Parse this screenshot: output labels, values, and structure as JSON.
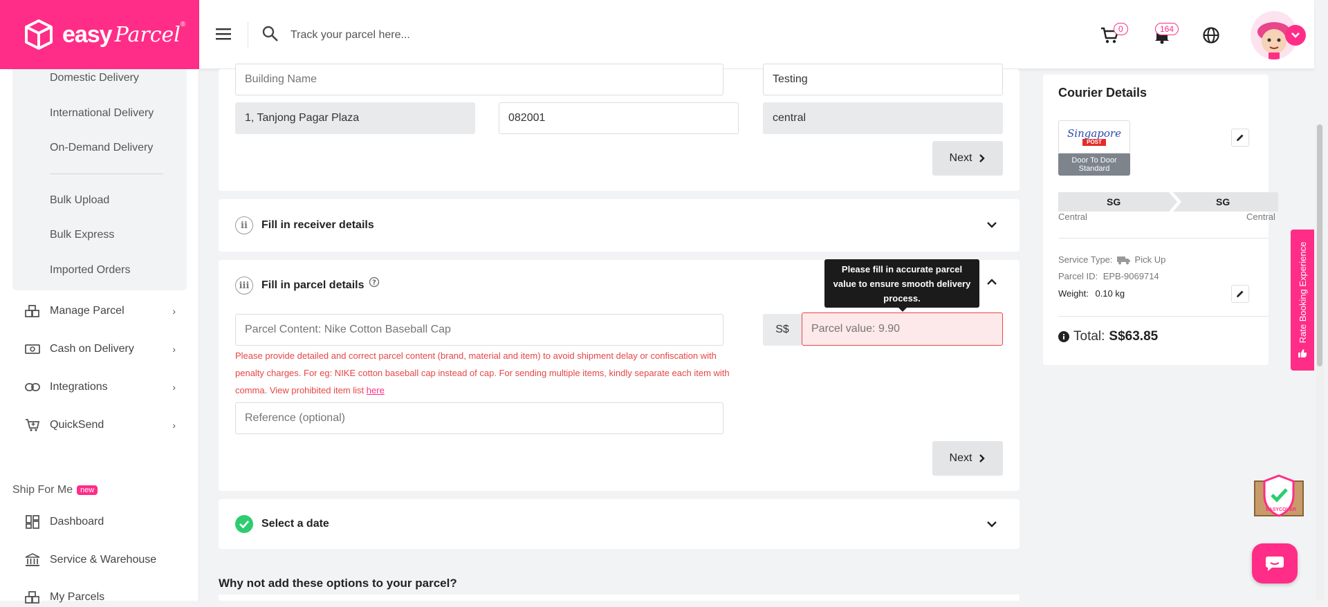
{
  "brand": {
    "name_bold": "easy",
    "name_script": "Parcel",
    "reg": "®"
  },
  "header": {
    "search_placeholder": "Track your parcel here...",
    "cart_count": "0",
    "notification_count": "164"
  },
  "sidebar": {
    "sub_items": [
      "Domestic Delivery",
      "International Delivery",
      "On-Demand Delivery",
      "Bulk Upload",
      "Bulk Express",
      "Imported Orders"
    ],
    "nav": [
      {
        "label": "Manage Parcel",
        "icon": "boxes-icon"
      },
      {
        "label": "Cash on Delivery",
        "icon": "cash-icon"
      },
      {
        "label": "Integrations",
        "icon": "link-icon"
      },
      {
        "label": "QuickSend",
        "icon": "cart-plus-icon"
      }
    ],
    "ship_for_me": {
      "label": "Ship For Me",
      "badge": "new"
    },
    "ship_nav": [
      {
        "label": "Dashboard",
        "icon": "dashboard-icon"
      },
      {
        "label": "Service & Warehouse",
        "icon": "bank-icon"
      },
      {
        "label": "My Parcels",
        "icon": "boxes-icon"
      }
    ]
  },
  "sender": {
    "building_placeholder": "Building Name",
    "name_value": "Testing",
    "address_value": "1, Tanjong Pagar Plaza",
    "postcode_value": "082001",
    "region_value": "central",
    "next_label": "Next"
  },
  "receiver": {
    "roman": "ii",
    "title": "Fill in receiver details"
  },
  "parcel": {
    "roman": "iii",
    "title": "Fill in parcel details",
    "content_placeholder": "Parcel Content: Nike Cotton Baseball Cap",
    "currency": "S$",
    "value_placeholder": "Parcel value: 9.90",
    "tooltip": "Please fill in accurate parcel value to ensure smooth delivery process.",
    "warning": "Please provide detailed and correct parcel content (brand, material and item) to avoid shipment delay or confiscation with penalty charges. For eg: NIKE cotton baseball cap instead of cap. For sending multiple items, kindly separate each item with comma. View prohibited item list",
    "warning_link": "here",
    "reference_placeholder": "Reference (optional)",
    "next_label": "Next"
  },
  "date": {
    "title": "Select a date"
  },
  "addons_heading": "Why not add these options to your parcel?",
  "courier": {
    "title": "Courier Details",
    "logo_text": "Singapore",
    "logo_sub": "POST",
    "service_badge": "Door To Door Standard",
    "from_code": "SG",
    "to_code": "SG",
    "from_region": "Central",
    "to_region": "Central",
    "service_type_label": "Service Type:",
    "service_type_value": "Pick Up",
    "parcel_id_label": "Parcel ID:",
    "parcel_id_value": "EPB-9069714",
    "weight_label": "Weight:",
    "weight_value": "0.10 kg",
    "total_label": "Total:",
    "total_value": "S$63.85"
  },
  "rate_booking": "Rate Booking Experience",
  "easycover": "EASYCOVER",
  "colors": {
    "brand": "#ff2d87",
    "success": "#2ecc71",
    "error": "#e64545"
  }
}
